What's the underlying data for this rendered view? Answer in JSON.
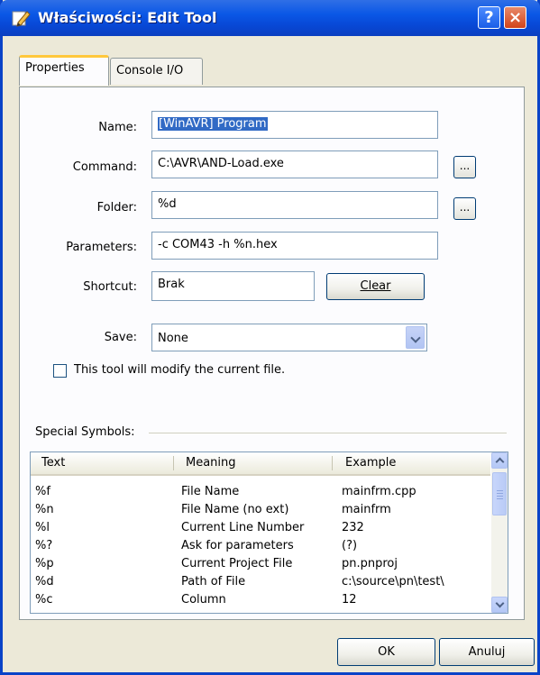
{
  "window": {
    "title": "Właściwości: Edit Tool"
  },
  "titlebar": {
    "help_glyph": "?",
    "close_glyph": "×"
  },
  "tabs": [
    {
      "label": "Properties",
      "active": true
    },
    {
      "label": "Console I/O",
      "active": false
    }
  ],
  "form": {
    "name_label": "Name:",
    "name_value": "[WinAVR] Program",
    "command_label": "Command:",
    "command_value": "C:\\AVR\\AND-Load.exe",
    "folder_label": "Folder:",
    "folder_value": "%d",
    "parameters_label": "Parameters:",
    "parameters_value": "-c COM43 -h %n.hex",
    "shortcut_label": "Shortcut:",
    "shortcut_value": "Brak",
    "clear_button": "Clear",
    "save_label": "Save:",
    "save_value": "None",
    "browse_label": "...",
    "modify_checkbox_label": "This tool will modify the current file.",
    "modify_checked": false
  },
  "symbols": {
    "group_label": "Special Symbols:",
    "columns": [
      "Text",
      "Meaning",
      "Example"
    ],
    "rows": [
      [
        "%f",
        "File Name",
        "mainfrm.cpp"
      ],
      [
        "%n",
        "File Name (no ext)",
        "mainfrm"
      ],
      [
        "%l",
        "Current Line Number",
        "232"
      ],
      [
        "%?",
        "Ask for parameters",
        "(?)"
      ],
      [
        "%p",
        "Current Project File",
        "pn.pnproj"
      ],
      [
        "%d",
        "Path of File",
        "c:\\source\\pn\\test\\"
      ],
      [
        "%c",
        "Column",
        "12"
      ]
    ]
  },
  "buttons": {
    "ok": "OK",
    "cancel": "Anuluj"
  },
  "colors": {
    "titlebar": "#0a57e6",
    "selection": "#316ac5",
    "dialog_bg": "#ece9d8"
  }
}
